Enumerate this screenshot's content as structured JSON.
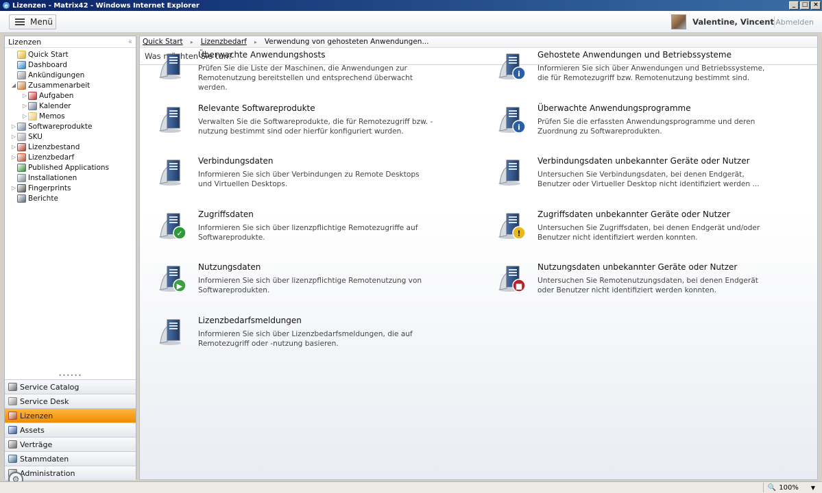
{
  "window": {
    "title": "Lizenzen - Matrix42 - Windows Internet Explorer",
    "buttons": [
      "_",
      "□",
      "×"
    ]
  },
  "header": {
    "menu_label": "Menü",
    "user_name": "Valentine, Vincent",
    "logout_label": "Abmelden"
  },
  "sidebar": {
    "title": "Lizenzen",
    "collapse_glyph": "«",
    "tree": [
      {
        "label": "Quick Start",
        "indent": 0,
        "expander": "",
        "icon": "star-icon",
        "color": "#e0b020"
      },
      {
        "label": "Dashboard",
        "indent": 0,
        "expander": "",
        "icon": "globe-icon",
        "color": "#2f7fbf"
      },
      {
        "label": "Ankündigungen",
        "indent": 0,
        "expander": "",
        "icon": "announcement-icon",
        "color": "#8a8a8a"
      },
      {
        "label": "Zusammenarbeit",
        "indent": 0,
        "expander": "◢",
        "icon": "people-icon",
        "color": "#c07830"
      },
      {
        "label": "Aufgaben",
        "indent": 1,
        "expander": "▷",
        "icon": "tasks-icon",
        "color": "#c03030"
      },
      {
        "label": "Kalender",
        "indent": 1,
        "expander": "▷",
        "icon": "calendar-icon",
        "color": "#6b7c99"
      },
      {
        "label": "Memos",
        "indent": 1,
        "expander": "▷",
        "icon": "folder-icon",
        "color": "#e8c060"
      },
      {
        "label": "Softwareprodukte",
        "indent": 0,
        "expander": "▷",
        "icon": "software-icon",
        "color": "#7a86a0"
      },
      {
        "label": "SKU",
        "indent": 0,
        "expander": "▷",
        "icon": "disc-icon",
        "color": "#9aa0a8"
      },
      {
        "label": "Lizenzbestand",
        "indent": 0,
        "expander": "▷",
        "icon": "license-stock-icon",
        "color": "#b04030"
      },
      {
        "label": "Lizenzbedarf",
        "indent": 0,
        "expander": "▷",
        "icon": "license-demand-icon",
        "color": "#c05030"
      },
      {
        "label": "Published Applications",
        "indent": 0,
        "expander": "",
        "icon": "published-apps-icon",
        "color": "#3a8a3a"
      },
      {
        "label": "Installationen",
        "indent": 0,
        "expander": "",
        "icon": "installations-icon",
        "color": "#7a8a9a"
      },
      {
        "label": "Fingerprints",
        "indent": 0,
        "expander": "▷",
        "icon": "fingerprint-icon",
        "color": "#555"
      },
      {
        "label": "Berichte",
        "indent": 0,
        "expander": "",
        "icon": "reports-icon",
        "color": "#5a6a7a"
      }
    ],
    "splitter_glyph": "••••••",
    "nav": [
      {
        "label": "Service Catalog",
        "icon": "service-catalog-icon",
        "color": "#6a6a6a",
        "active": false
      },
      {
        "label": "Service Desk",
        "icon": "service-desk-icon",
        "color": "#8a8a8a",
        "active": false
      },
      {
        "label": "Lizenzen",
        "icon": "licenses-icon",
        "color": "#b0502a",
        "active": true
      },
      {
        "label": "Assets",
        "icon": "assets-icon",
        "color": "#3a5a9a",
        "active": false
      },
      {
        "label": "Verträge",
        "icon": "contracts-icon",
        "color": "#6a6a6a",
        "active": false
      },
      {
        "label": "Stammdaten",
        "icon": "master-data-icon",
        "color": "#4a6a8a",
        "active": false
      },
      {
        "label": "Administration",
        "icon": "administration-icon",
        "color": "#6a6a6a",
        "active": false
      }
    ]
  },
  "breadcrumb": {
    "items": [
      "Quick Start",
      "Lizenzbedarf"
    ],
    "current": "Verwendung von gehosteten Anwendungen...",
    "separator": "▸"
  },
  "main": {
    "question": "Was möchten Sie tun?",
    "cards": [
      {
        "title": "Überwachte Anwendungshosts",
        "desc": "Prüfen Sie die Liste der Maschinen, die Anwendungen zur Remotenutzung bereitstellen und entsprechend überwacht werden.",
        "icon": "server-hosts-icon",
        "badge": ""
      },
      {
        "title": "Gehostete Anwendungen und Betriebssysteme",
        "desc": "Informieren Sie sich über Anwendungen und Betriebssysteme, die für Remotezugriff bzw. Remotenutzung bestimmt sind.",
        "icon": "hosted-apps-info-icon",
        "badge": "i"
      },
      {
        "title": "Relevante Softwareprodukte",
        "desc": "Verwalten Sie die Softwareprodukte, die für Remotezugriff bzw. -nutzung bestimmt sind oder hierfür konfiguriert wurden.",
        "icon": "software-product-box-icon",
        "badge": ""
      },
      {
        "title": "Überwachte Anwendungsprogramme",
        "desc": "Prüfen Sie die erfassten Anwendungsprogramme und deren Zuordnung zu Softwareprodukten.",
        "icon": "gear-info-icon",
        "badge": "i"
      },
      {
        "title": "Verbindungsdaten",
        "desc": "Informieren Sie sich über Verbindungen zu Remote Desktops und Virtuellen Desktops.",
        "icon": "connection-data-icon",
        "badge": ""
      },
      {
        "title": "Verbindungsdaten unbekannter Geräte oder Nutzer",
        "desc": "Untersuchen Sie Verbindungsdaten, bei denen Endgerät, Benutzer oder Virtueller Desktop nicht identifiziert werden ...",
        "icon": "connection-unknown-icon",
        "badge": ""
      },
      {
        "title": "Zugriffsdaten",
        "desc": "Informieren Sie sich über lizenzpflichtige Remotezugriffe auf Softwareprodukte.",
        "icon": "access-data-check-icon",
        "badge": "✓"
      },
      {
        "title": "Zugriffsdaten unbekannter Geräte oder Nutzer",
        "desc": "Untersuchen Sie Zugriffsdaten, bei denen Endgerät und/oder Benutzer nicht identifiziert werden konnten.",
        "icon": "access-warning-icon",
        "badge": "!"
      },
      {
        "title": "Nutzungsdaten",
        "desc": "Informieren Sie sich über lizenzpflichtige Remotenutzung von Softwareprodukten.",
        "icon": "usage-data-play-icon",
        "badge": "▶"
      },
      {
        "title": "Nutzungsdaten unbekannter Geräte oder Nutzer",
        "desc": "Untersuchen Sie Remotenutzungsdaten, bei denen Endgerät oder Benutzer nicht identifiziert werden konnten.",
        "icon": "usage-unknown-stop-icon",
        "badge": "■"
      },
      {
        "title": "Lizenzbedarfsmeldungen",
        "desc": "Informieren Sie sich über Lizenzbedarfsmeldungen, die auf Remotezugriff oder -nutzung basieren.",
        "icon": "license-demand-report-icon",
        "badge": ""
      }
    ]
  },
  "statusbar": {
    "zoom": "100%",
    "zoom_arrow": "▼"
  }
}
